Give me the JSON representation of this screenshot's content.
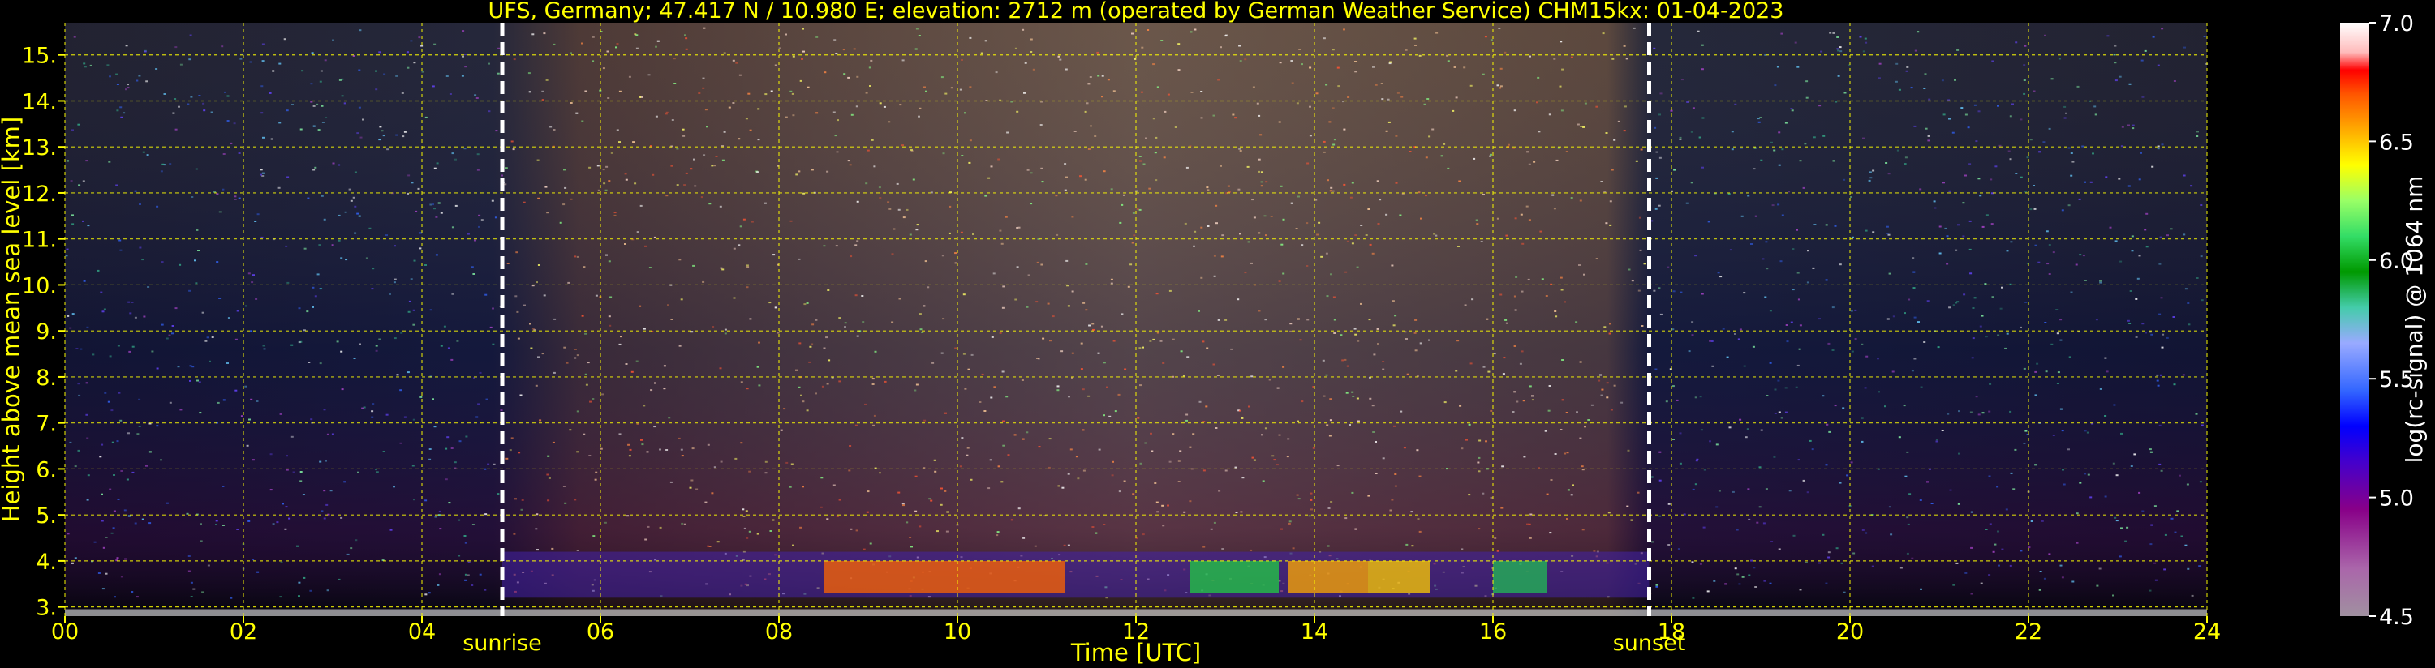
{
  "chart_data": {
    "type": "heatmap",
    "title": "UFS, Germany; 47.417 N / 10.980 E; elevation: 2712 m  (operated by German Weather Service)    CHM15kx: 01-04-2023",
    "xlabel": "Time [UTC]",
    "ylabel": "Height above mean sea level [km]",
    "xlim": [
      0,
      24
    ],
    "ylim": [
      2.8,
      15.7
    ],
    "x_ticks": [
      0,
      2,
      4,
      6,
      8,
      10,
      12,
      14,
      16,
      18,
      20,
      22,
      24
    ],
    "x_tick_labels": [
      "00",
      "02",
      "04",
      "06",
      "08",
      "10",
      "12",
      "14",
      "16",
      "18",
      "20",
      "22",
      "24"
    ],
    "y_ticks": [
      3,
      4,
      5,
      6,
      7,
      8,
      9,
      10,
      11,
      12,
      13,
      14,
      15
    ],
    "y_tick_labels": [
      "3.",
      "4.",
      "5.",
      "6.",
      "7.",
      "8.",
      "9.",
      "10.",
      "11.",
      "12.",
      "13.",
      "14.",
      "15."
    ],
    "grid": true,
    "events": [
      {
        "label": "sunrise",
        "time": 4.9
      },
      {
        "label": "sunset",
        "time": 17.75
      }
    ],
    "colorbar": {
      "label": "log(rc-signal) @ 1064 nm",
      "range": [
        4.5,
        7.0
      ],
      "ticks": [
        "4.5",
        "5.0",
        "5.5",
        "6.0",
        "6.5",
        "7.0"
      ],
      "tick_values": [
        4.5,
        5.0,
        5.5,
        6.0,
        6.5,
        7.0
      ]
    }
  },
  "colors": {
    "background": "#000000",
    "axis_text": "#ffff00",
    "grid": "#ffff00",
    "colorbar_text": "#ffffff",
    "event_line": "#ffffff"
  }
}
